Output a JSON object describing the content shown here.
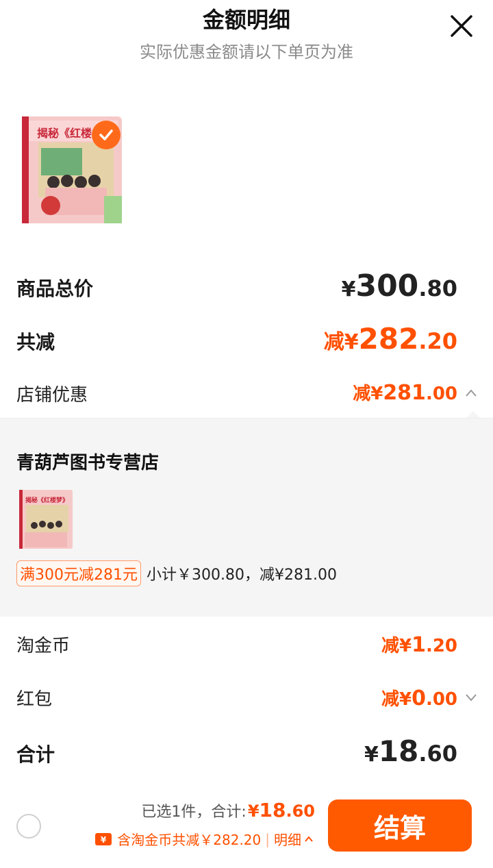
{
  "header": {
    "title": "金额明细",
    "subtitle": "实际优惠金额请以下单页为准"
  },
  "product": {
    "cover_title": "揭秘《红楼",
    "selected": true
  },
  "summary": {
    "total_label": "商品总价",
    "total_yen": "¥",
    "total_int": "300",
    "total_dec": ".80",
    "discount_label": "共减",
    "discount_prefix": "减",
    "discount_yen": "¥",
    "discount_int": "282",
    "discount_dec": ".20",
    "shop_label": "店铺优惠",
    "shop_prefix": "减",
    "shop_yen": "¥",
    "shop_int": "281",
    "shop_dec": ".00"
  },
  "shop_detail": {
    "shop_name": "青葫芦图书专营店",
    "thumb_title": "揭秘《红楼梦》",
    "promo_tag": "满300元减281元",
    "promo_subtotal": "小计￥300.80，减¥281.00"
  },
  "extras": {
    "coin_label": "淘金币",
    "coin_prefix": "减",
    "coin_yen": "¥",
    "coin_int": "1",
    "coin_dec": ".20",
    "redpack_label": "红包",
    "redpack_prefix": "减",
    "redpack_yen": "¥",
    "redpack_int": "0",
    "redpack_dec": ".00"
  },
  "grand_total": {
    "label": "合计",
    "yen": "¥",
    "int": "18",
    "dec": ".60"
  },
  "footer": {
    "selected_text": "已选1件，合计:",
    "sum_yen": "¥",
    "sum_int": "18",
    "sum_dec": ".60",
    "coin_text": "含淘金币共减￥282.20",
    "detail_link": "明细",
    "checkout_label": "结算"
  },
  "colors": {
    "accent": "#ff5000",
    "button": "#ff5a00",
    "panel_bg": "#f5f5f5"
  }
}
